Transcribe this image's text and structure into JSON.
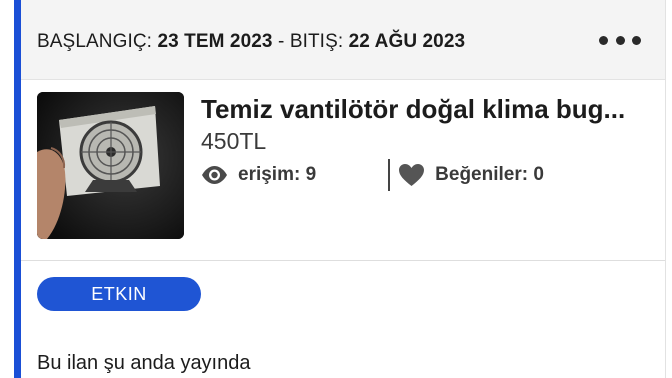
{
  "header": {
    "start_label": "BAŞLANGIÇ:",
    "start_date": "23 TEM  2023",
    "separator": "-",
    "end_label": "BITIŞ:",
    "end_date": "22 AĞU  2023",
    "more_icon": "more-horizontal-icon"
  },
  "listing": {
    "title": "Temiz vantilötör doğal klima bug...",
    "price": "450TL",
    "views_label": "erişim: 9",
    "likes_label": "Beğeniler: 0",
    "views_icon": "eye-icon",
    "likes_icon": "heart-icon"
  },
  "status": {
    "badge": "ETKIN",
    "message": "Bu ilan şu anda yayında"
  },
  "colors": {
    "accent": "#1a4fd6",
    "badge_bg": "#1f55d4",
    "header_bg": "#f4f4f4"
  }
}
